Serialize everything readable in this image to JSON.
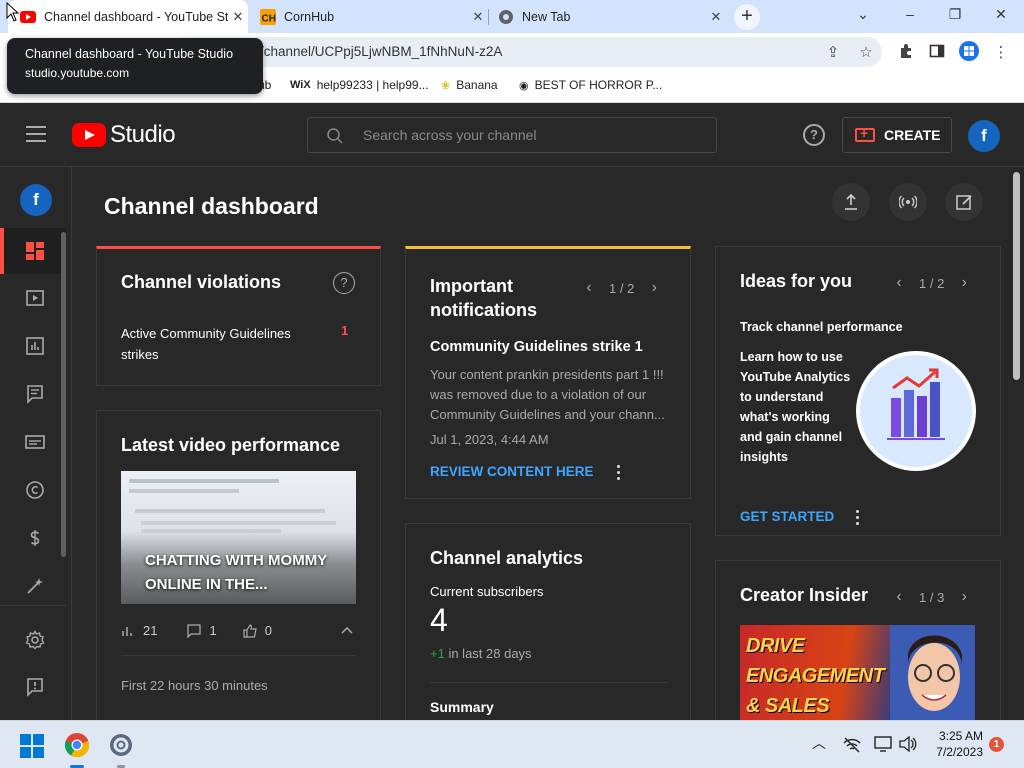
{
  "browser": {
    "tabs": [
      {
        "title": "Channel dashboard - YouTube Studio",
        "active": true
      },
      {
        "title": "CornHub",
        "active": false
      },
      {
        "title": "New Tab",
        "active": false
      }
    ],
    "url": "/channel/UCPpj5LjwNBM_1fNhNuN-z2A",
    "bookmarks": [
      {
        "label": "ub",
        "icon": "hub-icon"
      },
      {
        "label": "help99233 | help99...",
        "icon": "wix-icon"
      },
      {
        "label": "Banana",
        "icon": "banana-icon"
      },
      {
        "label": "BEST OF HORROR P...",
        "icon": "globe-icon"
      }
    ],
    "tooltip": {
      "title": "Channel dashboard - YouTube Studio",
      "domain": "studio.youtube.com"
    }
  },
  "header": {
    "logo_text": "Studio",
    "search_placeholder": "Search across your channel",
    "create_label": "CREATE",
    "avatar_letter": "f"
  },
  "sidebar": {
    "avatar_letter": "f",
    "items": [
      "dashboard-icon",
      "content-icon",
      "analytics-icon",
      "comments-icon",
      "subtitles-icon",
      "copyright-icon",
      "earn-icon",
      "customization-icon",
      "settings-icon",
      "feedback-icon"
    ]
  },
  "main": {
    "title": "Channel dashboard",
    "violations": {
      "title": "Channel violations",
      "row_label": "Active Community Guidelines strikes",
      "row_value": "1"
    },
    "latest_video": {
      "title": "Latest video performance",
      "thumb_title": "CHATTING WITH MOMMY ONLINE IN THE...",
      "views": "21",
      "comments": "1",
      "likes": "0",
      "period": "First 22 hours 30 minutes"
    },
    "notifications": {
      "title": "Important notifications",
      "pager": "1 / 2",
      "item_title": "Community Guidelines strike 1",
      "item_body": "Your content prankin presidents part 1 !!! was removed due to a violation of our Community Guidelines and your chann...",
      "date": "Jul 1, 2023, 4:44 AM",
      "action": "REVIEW CONTENT HERE"
    },
    "analytics": {
      "title": "Channel analytics",
      "subs_label": "Current subscribers",
      "subs_value": "4",
      "delta": "+1",
      "delta_suffix": "in last 28 days",
      "summary": "Summary"
    },
    "ideas": {
      "title": "Ideas for you",
      "pager": "1 / 2",
      "subtitle": "Track channel performance",
      "body": "Learn how to use YouTube Analytics to understand what's working and gain channel insights",
      "action": "GET STARTED"
    },
    "creator_insider": {
      "title": "Creator Insider",
      "pager": "1 / 3",
      "thumb_line1": "DRIVE",
      "thumb_line2": "ENGAGEMENT",
      "thumb_line3": "& SALES"
    }
  },
  "taskbar": {
    "time": "3:25 AM",
    "date": "7/2/2023",
    "notification_count": "1"
  },
  "colors": {
    "accent_red": "#ff4e45",
    "link_blue": "#3ea6ff",
    "strike_yellow": "#f9bf3b",
    "avatar_blue": "#1565c0"
  }
}
